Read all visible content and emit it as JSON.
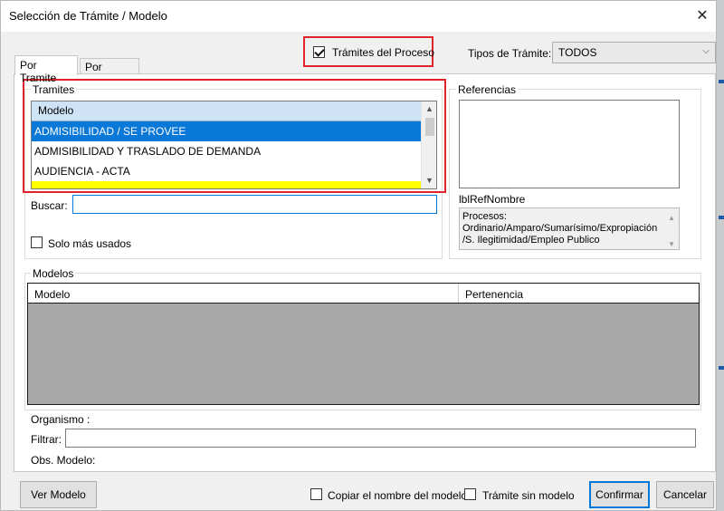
{
  "window": {
    "title": "Selección de Trámite / Modelo"
  },
  "header": {
    "tramites_proceso_label": "Trámites del Proceso",
    "tramites_proceso_checked": true,
    "tipos_label": "Tipos de Trámite:",
    "tipos_value": "TODOS"
  },
  "tabs": [
    {
      "label": "Por Tramite",
      "active": true
    },
    {
      "label": "Por Modelo",
      "active": false
    }
  ],
  "tramites": {
    "group_label": "Tramites",
    "column_header": "Modelo",
    "rows": [
      {
        "label": "ADMISIBILIDAD / SE PROVEE",
        "state": "selected"
      },
      {
        "label": "ADMISIBILIDAD Y TRASLADO DE DEMANDA",
        "state": "normal"
      },
      {
        "label": "AUDIENCIA - ACTA",
        "state": "normal"
      },
      {
        "label": "",
        "state": "highlight"
      }
    ],
    "buscar_label": "Buscar:",
    "buscar_value": "",
    "solo_usados_label": "Solo más usados",
    "solo_usados_checked": false
  },
  "referencias": {
    "group_label": "Referencias",
    "ref_nombre_label": "lblRefNombre",
    "procesos_text_1": "Procesos:",
    "procesos_text_2": "Ordinario/Amparo/Sumarísimo/Expropiación",
    "procesos_text_3": "/S. Ilegitimidad/Empleo Publico"
  },
  "modelos": {
    "group_label": "Modelos",
    "columns": [
      "Modelo",
      "Pertenencia"
    ]
  },
  "footer": {
    "organismo_label": "Organismo :",
    "filtrar_label": "Filtrar:",
    "filtrar_value": "",
    "obs_label": "Obs. Modelo:",
    "ver_modelo_label": "Ver Modelo",
    "copiar_label": "Copiar el nombre del modelo",
    "copiar_checked": false,
    "sin_modelo_label": "Trámite sin modelo",
    "sin_modelo_checked": false,
    "confirmar_label": "Confirmar",
    "cancelar_label": "Cancelar"
  },
  "colors": {
    "selection": "#0a78d7",
    "highlight": "#ffff00",
    "annotation_red": "#e0242c",
    "header_blue": "#cfe3f7"
  }
}
